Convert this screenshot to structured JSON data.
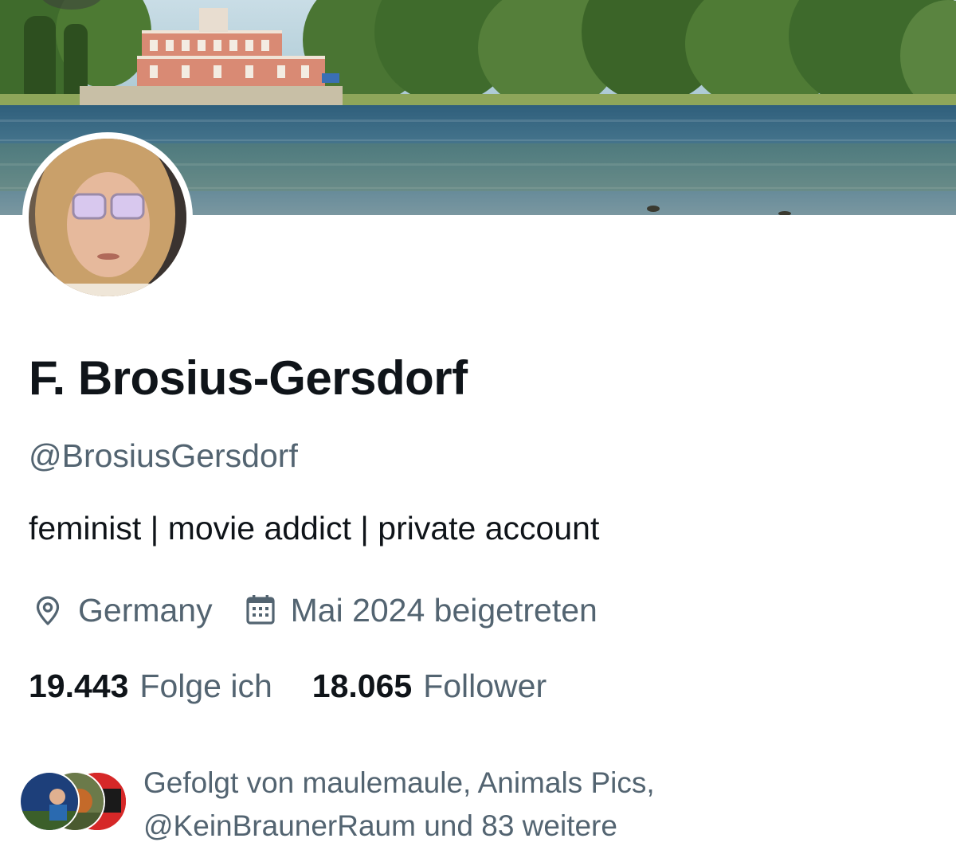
{
  "profile": {
    "display_name": "F. Brosius-Gersdorf",
    "handle": "@BrosiusGersdorf",
    "bio": "feminist | movie addict | private account",
    "location": "Germany",
    "joined": "Mai 2024 beigetreten",
    "following_count": "19.443",
    "following_label": "Folge ich",
    "followers_count": "18.065",
    "followers_label": "Follower"
  },
  "followed_by": {
    "line1": "Gefolgt von maulemaule, Animals Pics,",
    "line2": "@KeinBraunerRaum und 83 weitere"
  },
  "icons": {
    "location": "location-pin-icon",
    "joined": "calendar-icon"
  },
  "colors": {
    "primary_text": "#0f1419",
    "secondary_text": "#536471",
    "background": "#ffffff"
  }
}
